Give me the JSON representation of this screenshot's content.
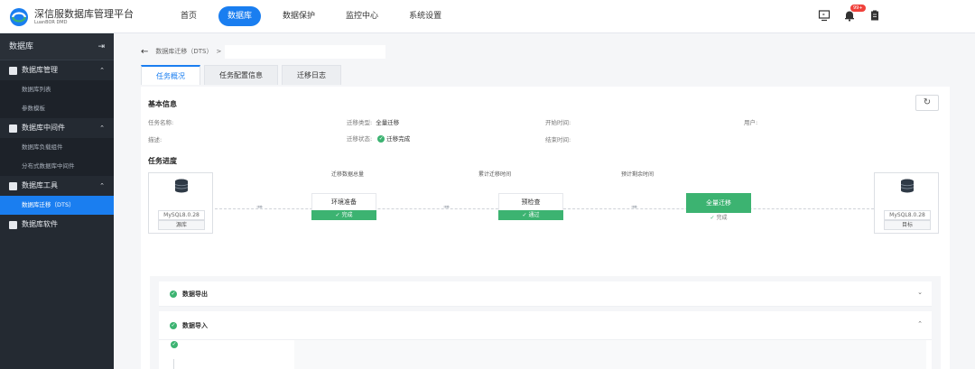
{
  "header": {
    "app_title": "深信服数据库管理平台",
    "app_subtitle": "LuanBOR DMD",
    "nav": [
      "首页",
      "数据库",
      "数据保护",
      "监控中心",
      "系统设置"
    ],
    "active_nav": "数据库",
    "notification_count": "99+"
  },
  "sidebar": {
    "title": "数据库",
    "groups": [
      {
        "label": "数据库管理",
        "items": [
          "数据库列表",
          "参数模板"
        ]
      },
      {
        "label": "数据库中间件",
        "items": [
          "数据库负载组件",
          "分布式数据库中间件"
        ]
      },
      {
        "label": "数据库工具",
        "items": [
          "数据库迁移（DTS）"
        ]
      },
      {
        "label": "数据库软件",
        "items": []
      }
    ],
    "active_item": "数据库迁移（DTS）"
  },
  "breadcrumb": {
    "text": "数据库迁移（DTS）",
    "separator": ">"
  },
  "tabs": [
    "任务概况",
    "任务配置信息",
    "迁移日志"
  ],
  "basic_info": {
    "title": "基本信息",
    "fields": {
      "task_name": {
        "label": "任务名称:",
        "value": ""
      },
      "migrate_type": {
        "label": "迁移类型:",
        "value": "全量迁移"
      },
      "start_time": {
        "label": "开始时间:",
        "value": ""
      },
      "user": {
        "label": "用户:",
        "value": ""
      },
      "description": {
        "label": "描述:",
        "value": ""
      },
      "migrate_status": {
        "label": "迁移状态:",
        "value": "迁移完成"
      },
      "end_time": {
        "label": "结束时间:",
        "value": ""
      }
    }
  },
  "progress": {
    "title": "任务进度",
    "labels": [
      "迁移数据总量",
      "累计迁移时间",
      "预计剩余时间"
    ],
    "source": {
      "name": "MySQL8.0.28",
      "role": "源库"
    },
    "target": {
      "name": "MySQL8.0.28",
      "role": "目标"
    },
    "stages": [
      {
        "name": "环境准备",
        "status": "完成"
      },
      {
        "name": "预检查",
        "status": "通过"
      },
      {
        "name": "全量迁移",
        "status": "完成"
      }
    ]
  },
  "sections": [
    {
      "title": "数据导出",
      "expanded": false
    },
    {
      "title": "数据导入",
      "expanded": true
    }
  ],
  "colors": {
    "accent": "#1a7ef0",
    "success": "#3cb371",
    "sidebar": "#242a32"
  }
}
